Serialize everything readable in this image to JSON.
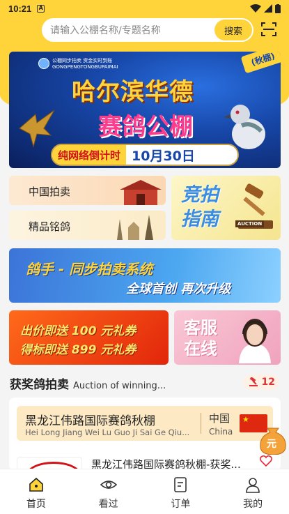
{
  "status": {
    "time": "10:21",
    "app_indicator": "A"
  },
  "search": {
    "placeholder": "请输入公棚名称/专题名称",
    "button": "搜索"
  },
  "banner": {
    "logo_text": "公棚同步拍卖 资金实时到账",
    "logo_pinyin": "GONGPENGTONGBUPAIMAI",
    "corner_tag": "(秋棚)",
    "title_line1": "哈尔滨华德",
    "title_line2": "赛鸽公棚",
    "countdown_label": "纯网络倒计时",
    "countdown_date": "10月30日"
  },
  "menu": {
    "china_auction": "中国拍卖",
    "premium_pigeons": "精品铭鸽",
    "guide_line1": "竞拍",
    "guide_line2": "指南",
    "auction_sign": "AUCTION"
  },
  "sync_banner": {
    "line1": "鸽手 - 同步拍卖系统",
    "line2": "全球首创 再次升级"
  },
  "promo": {
    "line1": "出价即送 100 元礼券",
    "line2": "得标即送 899 元礼券"
  },
  "service": {
    "line1": "客服",
    "line2": "在线"
  },
  "section": {
    "title_zh": "获奖鸽拍卖",
    "title_en": "Auction of winning...",
    "count": "12"
  },
  "listing": {
    "venue_name": "黑龙江伟路国际赛鸽秋棚",
    "venue_pinyin": "Hei Long Jiang Wei Lu Guo Ji Sai Ge Qiu...",
    "country_zh": "中国",
    "country_en": "China",
    "item_title": "黑龙江伟路国际赛鸽秋棚-获奖...",
    "float_badge": "元"
  },
  "tabs": [
    {
      "label": "首页",
      "icon": "home-icon"
    },
    {
      "label": "看过",
      "icon": "eye-icon"
    },
    {
      "label": "订单",
      "icon": "order-icon"
    },
    {
      "label": "我的",
      "icon": "user-icon"
    }
  ],
  "colors": {
    "brand_yellow": "#ffd43b",
    "accent_red": "#d0141a",
    "blue": "#3a8de0"
  }
}
